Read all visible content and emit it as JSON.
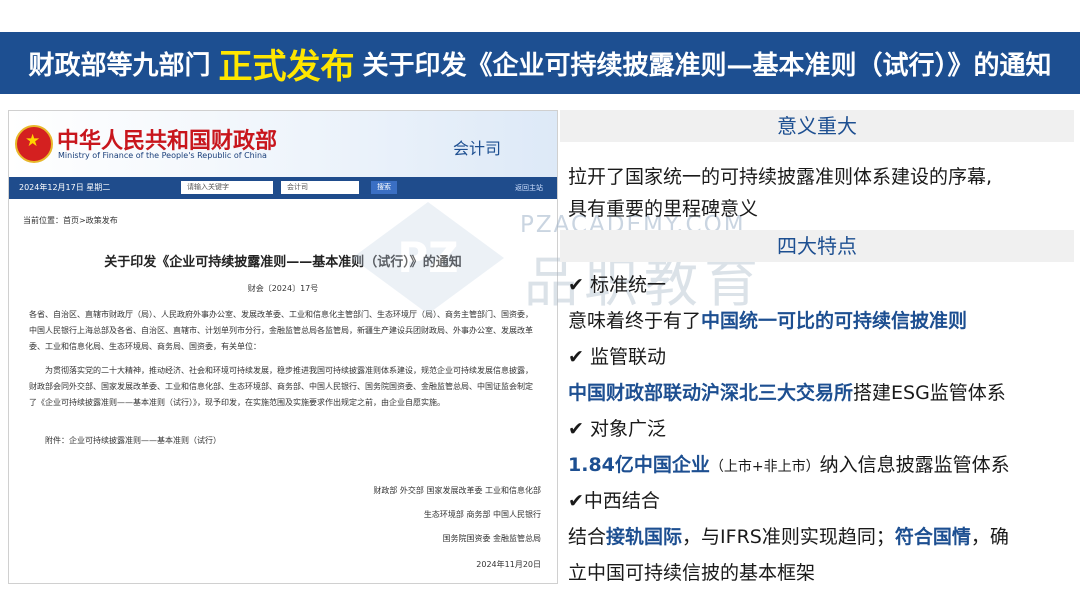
{
  "banner": {
    "prefix": "财政部等九部门",
    "highlight": "正式发布",
    "suffix": "关于印发《企业可持续披露准则—基本准则（试行）》的通知"
  },
  "screenshot": {
    "cn_name": "中华人民共和国财政部",
    "en_name": "Ministry of Finance of the People's Republic of China",
    "dept": "会计司",
    "date": "2024年12月17日 星期二",
    "search_placeholder": "请输入关键字",
    "search_scope": "会计司",
    "search_button": "搜索",
    "back_home": "返回主站",
    "breadcrumb": "当前位置：首页>政策发布",
    "doc_title": "关于印发《企业可持续披露准则——基本准则（试行）》的通知",
    "doc_no": "财会〔2024〕17号",
    "recipients": "各省、自治区、直辖市财政厅（局）、人民政府外事办公室、发展改革委、工业和信息化主管部门、生态环境厅（局）、商务主管部门、国资委，中国人民银行上海总部及各省、自治区、直辖市、计划单列市分行，金融监管总局各监管局，新疆生产建设兵团财政局、外事办公室、发展改革委、工业和信息化局、生态环境局、商务局、国资委，有关单位：",
    "body": "为贯彻落实党的二十大精神，推动经济、社会和环境可持续发展，稳步推进我国可持续披露准则体系建设，规范企业可持续发展信息披露，财政部会同外交部、国家发展改革委、工业和信息化部、生态环境部、商务部、中国人民银行、国务院国资委、金融监管总局、中国证监会制定了《企业可持续披露准则——基本准则（试行）》，现予印发，在实施范围及实施要求作出规定之前，由企业自愿实施。",
    "attachment": "附件：企业可持续披露准则——基本准则（试行）",
    "sign1": "财政部 外交部 国家发展改革委 工业和信息化部",
    "sign2": "生态环境部 商务部 中国人民银行",
    "sign3": "国务院国资委 金融监管总局",
    "sign_date": "2024年11月20日"
  },
  "watermark": {
    "text": "PZACADEMY.COM",
    "cn": "品职教育"
  },
  "right": {
    "section1_title": "意义重大",
    "section1_line1": "拉开了国家统一的可持续披露准则体系建设的序幕,",
    "section1_line2": "具有重要的里程碑意义",
    "section2_title": "四大特点",
    "f1_title": "✔ 标准统一",
    "f1_a": "意味着终于有了",
    "f1_b": "中国统一可比的可持续信披准则",
    "f2_title": "✔ 监管联动",
    "f2_a": "中国财政部联动沪深北三大交易所",
    "f2_b": "搭建ESG监管体系",
    "f3_title": "✔ 对象广泛",
    "f3_a": "1.84亿中国企业",
    "f3_b": "（上市+非上市）",
    "f3_c": "纳入信息披露监管体系",
    "f4_title": "✔中西结合",
    "f4_a": "结合",
    "f4_b": "接轨国际",
    "f4_c": "，与IFRS准则实现趋同；",
    "f4_d": "符合国情",
    "f4_e": "，确",
    "f4_f": "立中国可持续信披的基本框架"
  },
  "colors": {
    "banner_bg": "#1d4f91",
    "highlight": "#ffe600",
    "accent_blue": "#1d4f91",
    "ministry_red": "#c8161d"
  }
}
